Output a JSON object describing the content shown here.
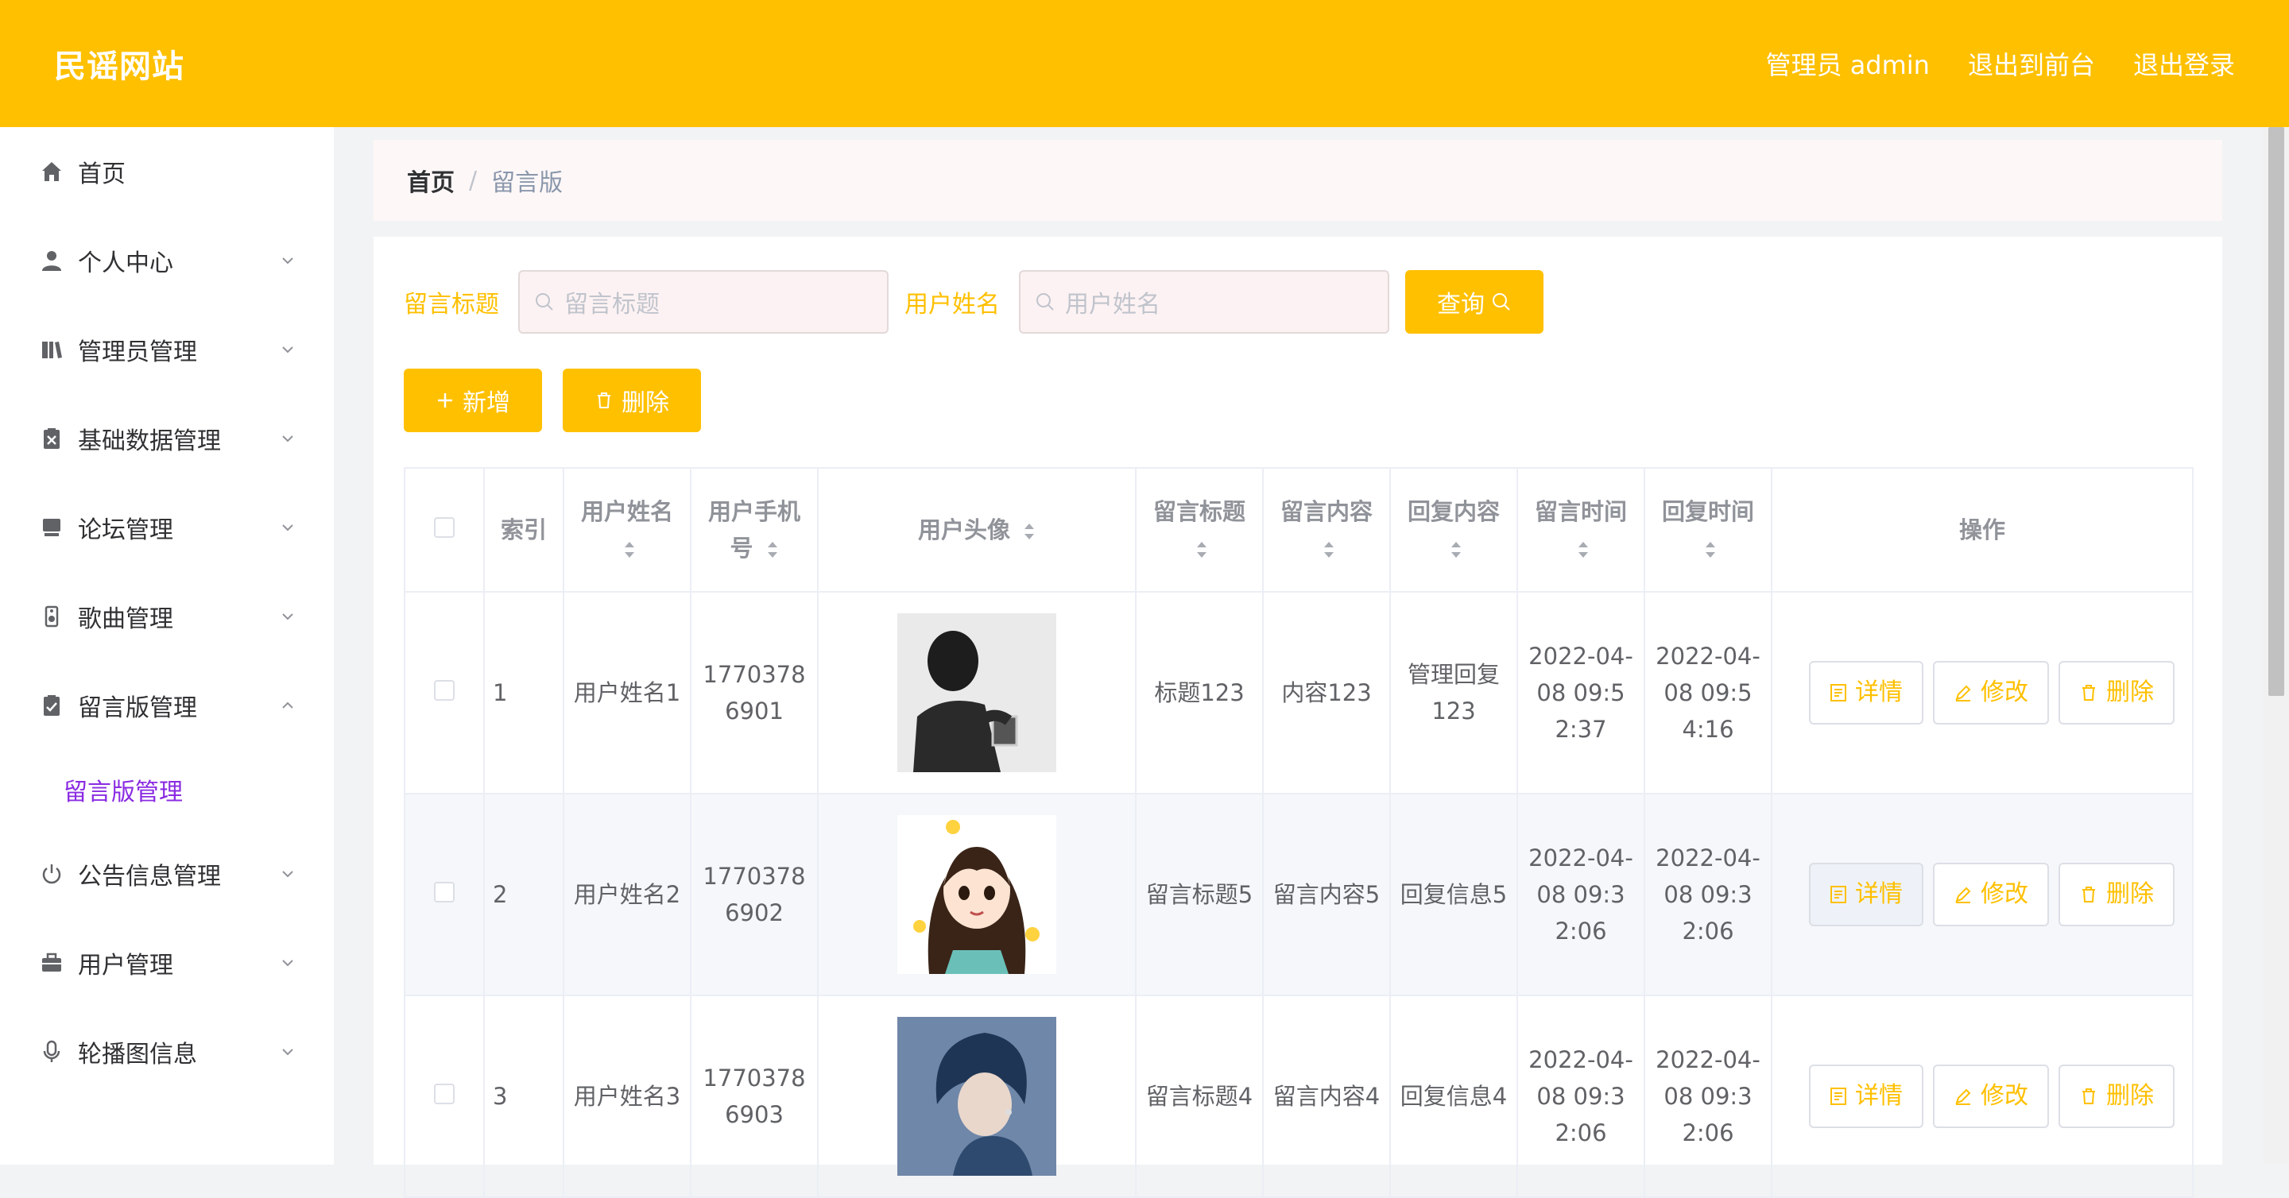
{
  "header": {
    "brand": "民谣网站",
    "admin_label": "管理员 admin",
    "to_front": "退出到前台",
    "logout": "退出登录",
    "accent": "#ffc000"
  },
  "sidebar": {
    "items": [
      {
        "label": "首页",
        "icon": "home-icon"
      },
      {
        "label": "个人中心",
        "icon": "user-icon"
      },
      {
        "label": "管理员管理",
        "icon": "book-icon"
      },
      {
        "label": "基础数据管理",
        "icon": "clipboard-x-icon"
      },
      {
        "label": "论坛管理",
        "icon": "forum-icon"
      },
      {
        "label": "歌曲管理",
        "icon": "speaker-icon"
      },
      {
        "label": "留言版管理",
        "icon": "clipboard-check-icon"
      },
      {
        "label": "公告信息管理",
        "icon": "power-icon"
      },
      {
        "label": "用户管理",
        "icon": "briefcase-icon"
      },
      {
        "label": "轮播图信息",
        "icon": "microphone-icon"
      }
    ],
    "submenu_active": "留言版管理"
  },
  "breadcrumb": {
    "home": "首页",
    "sep": "/",
    "current": "留言版"
  },
  "search": {
    "title_label": "留言标题",
    "title_placeholder": "留言标题",
    "name_label": "用户姓名",
    "name_placeholder": "用户姓名",
    "query_button": "查询"
  },
  "actions": {
    "add": "新增",
    "delete": "删除"
  },
  "table": {
    "headers": {
      "index": "索引",
      "username": "用户姓名",
      "phone": "用户手机号",
      "avatar": "用户头像",
      "title": "留言标题",
      "content": "留言内容",
      "reply": "回复内容",
      "msg_time": "留言时间",
      "reply_time": "回复时间",
      "ops": "操作"
    },
    "rows": [
      {
        "index": "1",
        "username": "用户姓名1",
        "phone": "17703786901",
        "title": "标题123",
        "content": "内容123",
        "reply": "管理回复123",
        "msg_time": "2022-04-08 09:52:37",
        "reply_time": "2022-04-08 09:54:16"
      },
      {
        "index": "2",
        "username": "用户姓名2",
        "phone": "17703786902",
        "title": "留言标题5",
        "content": "留言内容5",
        "reply": "回复信息5",
        "msg_time": "2022-04-08 09:32:06",
        "reply_time": "2022-04-08 09:32:06"
      },
      {
        "index": "3",
        "username": "用户姓名3",
        "phone": "17703786903",
        "title": "留言标题4",
        "content": "留言内容4",
        "reply": "回复信息4",
        "msg_time": "2022-04-08 09:32:06",
        "reply_time": "2022-04-08 09:32:06"
      }
    ],
    "op_labels": {
      "detail": "详情",
      "edit": "修改",
      "delete": "删除"
    }
  }
}
